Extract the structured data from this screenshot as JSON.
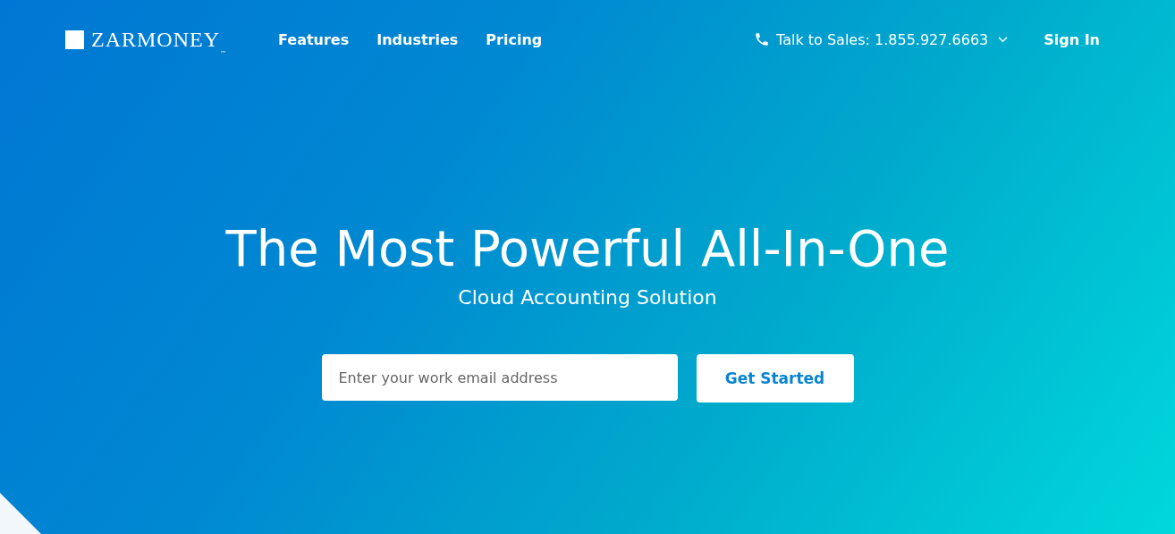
{
  "header": {
    "logo_text": "ZARMONEY",
    "logo_mark": "™",
    "nav": [
      "Features",
      "Industries",
      "Pricing"
    ],
    "sales": "Talk to Sales: 1.855.927.6663",
    "sign_in": "Sign In"
  },
  "hero": {
    "title": "The Most Powerful All-In-One",
    "subtitle": "Cloud Accounting Solution",
    "email": {
      "placeholder": "Enter your work email address"
    },
    "button": "Get Started"
  }
}
